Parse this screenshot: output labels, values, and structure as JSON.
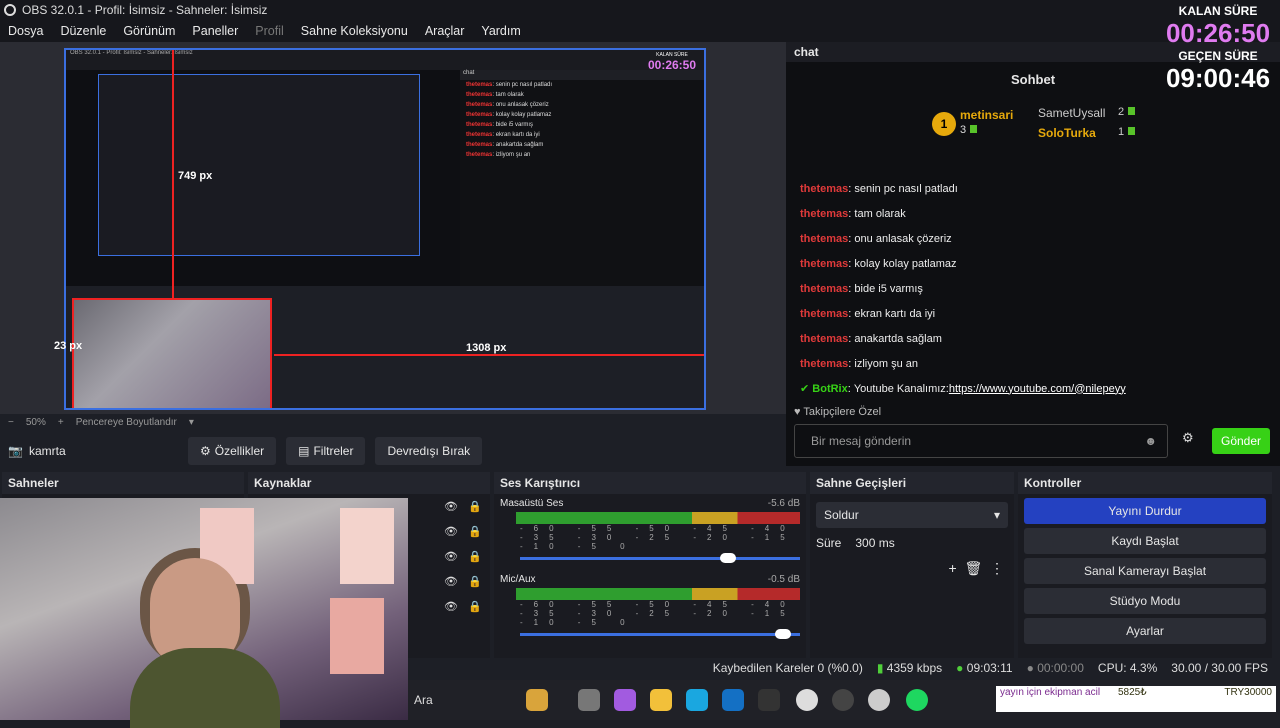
{
  "titlebar": {
    "title": "OBS 32.0.1 - Profil: İsimsiz - Sahneler: İsimsiz"
  },
  "menu": [
    {
      "label": "Dosya",
      "dim": false
    },
    {
      "label": "Düzenle",
      "dim": false
    },
    {
      "label": "Görünüm",
      "dim": false
    },
    {
      "label": "Paneller",
      "dim": false
    },
    {
      "label": "Profil",
      "dim": true
    },
    {
      "label": "Sahne Koleksiyonu",
      "dim": false
    },
    {
      "label": "Araçlar",
      "dim": false
    },
    {
      "label": "Yardım",
      "dim": false
    }
  ],
  "preview": {
    "measure_1": "749 px",
    "measure_2": "23 px",
    "measure_3": "1308 px",
    "zoom": "50%",
    "fit_label": "Pencereye Boyutlandır"
  },
  "source_toolbar": {
    "source_name": "kamrta",
    "properties": "Özellikler",
    "filters": "Filtreler",
    "disable": "Devredışı Bırak"
  },
  "timer": {
    "remaining_label": "KALAN SÜRE",
    "remaining": "00:26:50",
    "elapsed_label": "GEÇEN SÜRE",
    "elapsed": "09:00:46"
  },
  "chat": {
    "dock_title": "chat",
    "header": "Sohbet",
    "podium": [
      {
        "rank": "1",
        "name": "metinsari",
        "count": "3"
      },
      {
        "rank": "2",
        "name": "SametUysall",
        "count": "2"
      },
      {
        "rank": "3",
        "name": "SoloTurka",
        "count": "1"
      }
    ],
    "messages": [
      {
        "user": "thetemas",
        "text": "senin pc nasıl patladı"
      },
      {
        "user": "thetemas",
        "text": "tam olarak"
      },
      {
        "user": "thetemas",
        "text": "onu anlasak çözeriz"
      },
      {
        "user": "thetemas",
        "text": "kolay kolay patlamaz"
      },
      {
        "user": "thetemas",
        "text": "bide i5 varmış"
      },
      {
        "user": "thetemas",
        "text": "ekran kartı da iyi"
      },
      {
        "user": "thetemas",
        "text": "anakartda sağlam"
      },
      {
        "user": "thetemas",
        "text": "izliyom şu an"
      }
    ],
    "bot_message": {
      "user": "BotRix",
      "text": "Youtube Kanalımız: ",
      "link": "https://www.youtube.com/@nilepeyy"
    },
    "followers_only": "Takipçilere Özel",
    "input_placeholder": "Bir mesaj gönderin",
    "send": "Gönder"
  },
  "docks": {
    "scenes": "Sahneler",
    "sources": "Kaynaklar",
    "mixer": "Ses Karıştırıcı",
    "transitions": "Sahne Geçişleri",
    "controls": "Kontroller"
  },
  "mixer": {
    "channels": [
      {
        "name": "Masaüstü Ses",
        "level": "-5.6 dB",
        "fader": 0.7
      },
      {
        "name": "Mic/Aux",
        "level": "-0.5 dB",
        "fader": 0.95
      }
    ],
    "scale": "-60 -55 -50 -45 -40 -35 -30 -25 -20 -15 -10 -5 0"
  },
  "transitions": {
    "type": "Soldur",
    "duration_label": "Süre",
    "duration": "300 ms"
  },
  "controls": {
    "stop_stream": "Yayını Durdur",
    "start_record": "Kaydı Başlat",
    "virtual_cam": "Sanal Kamerayı Başlat",
    "studio": "Stüdyo Modu",
    "settings": "Ayarlar"
  },
  "status": {
    "dropped": "Kaybedilen Kareler 0 (%0.0)",
    "bitrate": "4359 kbps",
    "stream_time": "09:03:11",
    "rec_time": "00:00:00",
    "cpu": "CPU: 4.3%",
    "fps": "30.00 / 30.00 FPS"
  },
  "taskbar": {
    "search": "Ara"
  },
  "ticker": {
    "text": "yayın için ekipman acil",
    "amount1": "5825₺",
    "amount2": "TRY30000"
  },
  "colors": {
    "accent": "#2441c1",
    "send": "#37d116",
    "timer": "#e07bf0",
    "chat_user": "#e03a3a"
  }
}
